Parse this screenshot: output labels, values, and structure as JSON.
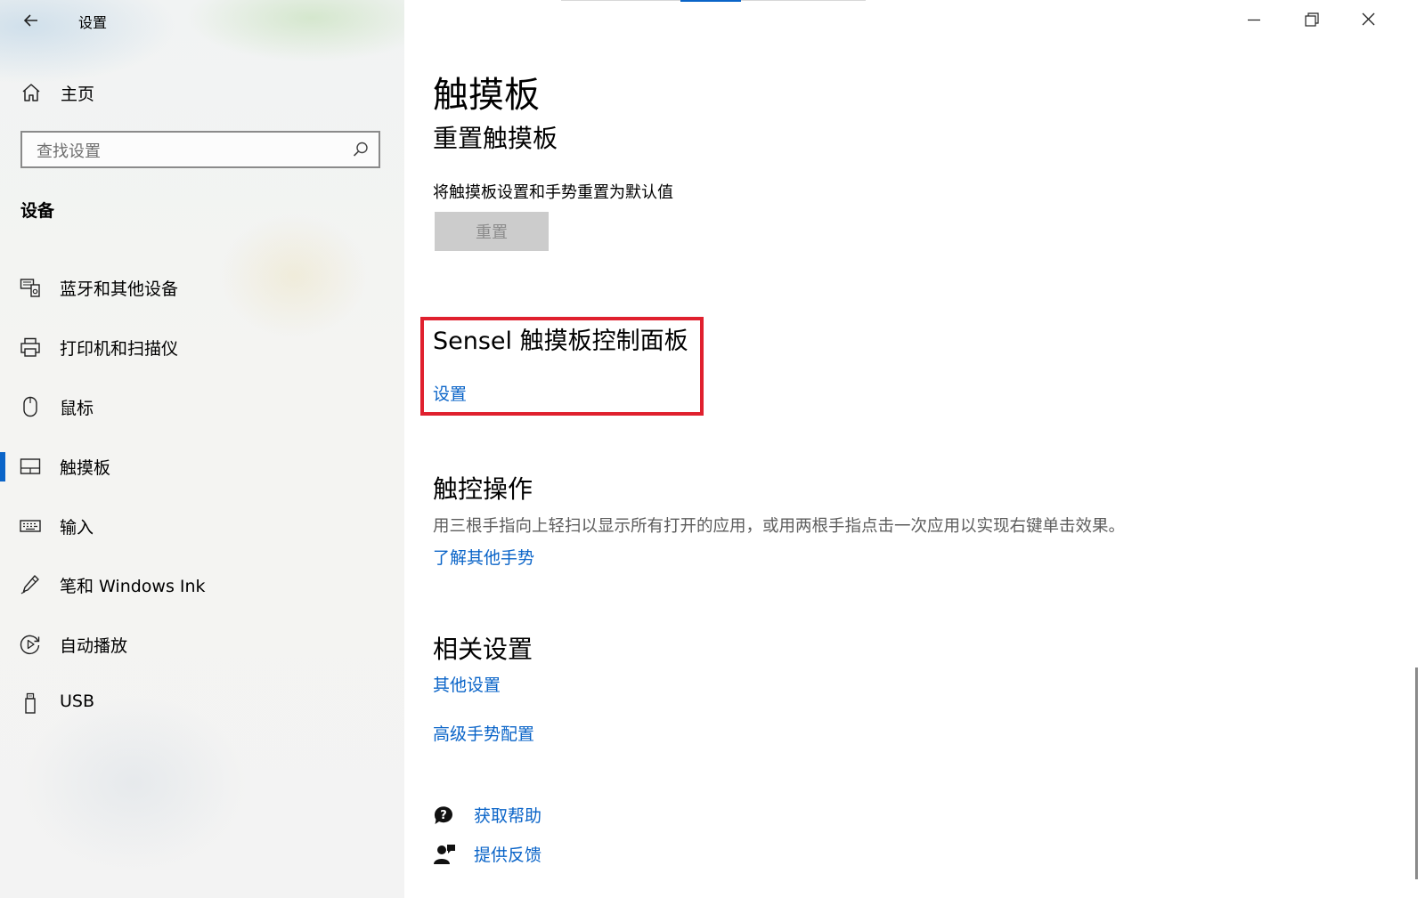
{
  "window": {
    "title": "设置"
  },
  "sidebar": {
    "home_label": "主页",
    "search_placeholder": "查找设置",
    "section_title": "设备",
    "items": [
      {
        "label": "蓝牙和其他设备",
        "icon": "bluetooth-devices-icon"
      },
      {
        "label": "打印机和扫描仪",
        "icon": "printer-icon"
      },
      {
        "label": "鼠标",
        "icon": "mouse-icon"
      },
      {
        "label": "触摸板",
        "icon": "touchpad-icon",
        "active": true
      },
      {
        "label": "输入",
        "icon": "keyboard-icon"
      },
      {
        "label": "笔和 Windows Ink",
        "icon": "pen-icon"
      },
      {
        "label": "自动播放",
        "icon": "autoplay-icon"
      },
      {
        "label": "USB",
        "icon": "usb-icon"
      }
    ]
  },
  "main": {
    "page_title": "触摸板",
    "reset": {
      "heading": "重置触摸板",
      "description": "将触摸板设置和手势重置为默认值",
      "button_label": "重置"
    },
    "sensel": {
      "heading": "Sensel 触摸板控制面板",
      "link": "设置"
    },
    "touch": {
      "heading": "触控操作",
      "description": "用三根手指向上轻扫以显示所有打开的应用，或用两根手指点击一次应用以实现右键单击效果。",
      "link": "了解其他手势"
    },
    "related": {
      "heading": "相关设置",
      "links": [
        "其他设置",
        "高级手势配置"
      ]
    },
    "help": {
      "get_help": "获取帮助",
      "feedback": "提供反馈"
    }
  },
  "colors": {
    "accent": "#0a64c8",
    "highlight_border": "#e0202e",
    "disabled_button_bg": "#cccccc"
  }
}
